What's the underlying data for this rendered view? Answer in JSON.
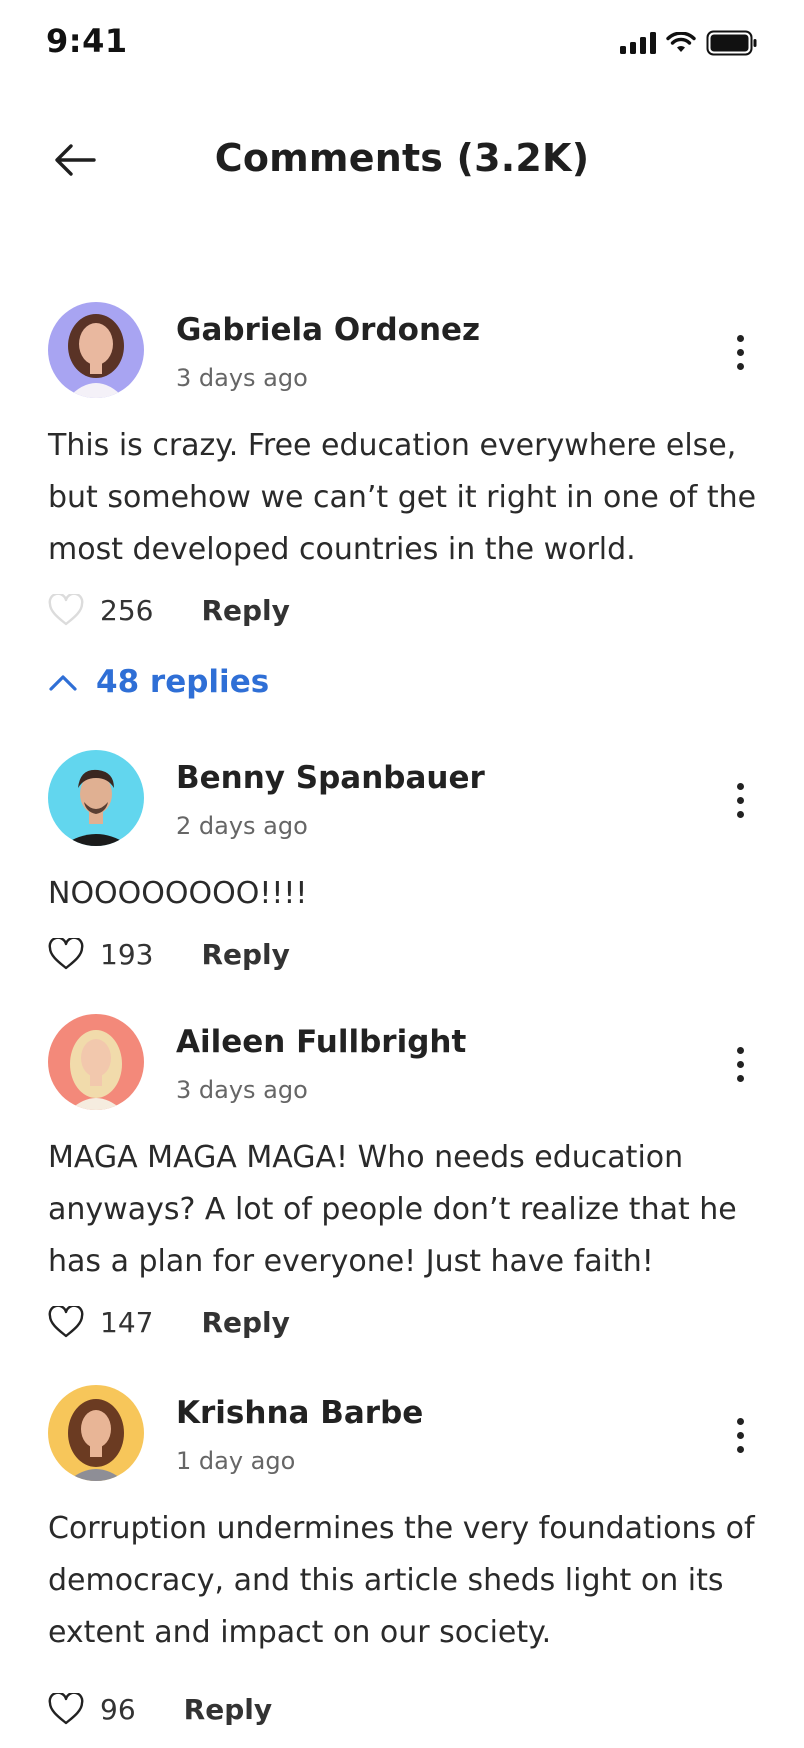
{
  "status_bar": {
    "time": "9:41",
    "icons": [
      "cellular-signal-icon",
      "wifi-icon",
      "battery-icon"
    ]
  },
  "header": {
    "title": "Comments (3.2K)",
    "back_icon": "arrow-left-icon"
  },
  "comments": [
    {
      "author": "Gabriela Ordonez",
      "time": "3 days ago",
      "text": "This is crazy. Free education everywhere else, but somehow we can’t get it right in one of the most developed countries in the world.",
      "likes": "256",
      "reply_label": "Reply",
      "avatar_bg": "#a8a4f2"
    },
    {
      "author": "Benny Spanbauer",
      "time": "2 days ago",
      "text": "NOOOOOOOO!!!!",
      "likes": "193",
      "reply_label": "Reply",
      "avatar_bg": "#62d6ee"
    },
    {
      "author": "Aileen Fullbright",
      "time": "3 days ago",
      "text": "MAGA MAGA MAGA! Who needs education anyways? A lot of people don’t realize that he has a plan for everyone! Just have faith!",
      "likes": "147",
      "reply_label": "Reply",
      "avatar_bg": "#f3897a"
    },
    {
      "author": "Krishna Barbe",
      "time": "1 day ago",
      "text": "Corruption undermines the very foundations of democracy, and this article sheds light on its extent and impact on our society.",
      "likes": "96",
      "reply_label": "Reply",
      "avatar_bg": "#f7c65a"
    }
  ],
  "replies_toggle": {
    "label": "48 replies",
    "expanded": true
  },
  "colors": {
    "accent": "#2f6fd6",
    "text": "#1f1f1f",
    "muted": "#666666"
  }
}
